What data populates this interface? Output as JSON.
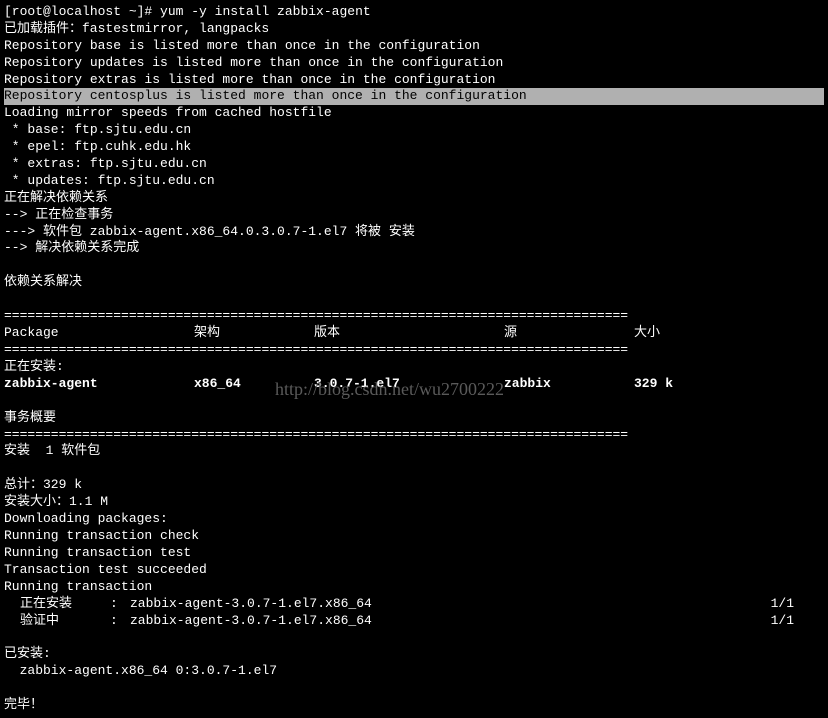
{
  "prompt": "[root@localhost ~]# ",
  "command": "yum -y install zabbix-agent",
  "plugins_line": "已加载插件：fastestmirror, langpacks",
  "repo_warn_base": "Repository base is listed more than once in the configuration",
  "repo_warn_updates": "Repository updates is listed more than once in the configuration",
  "repo_warn_extras": "Repository extras is listed more than once in the configuration",
  "repo_warn_centosplus": "Repository centosplus is listed more than once in the configuration",
  "loading_mirror": "Loading mirror speeds from cached hostfile",
  "mirror_base": " * base: ftp.sjtu.edu.cn",
  "mirror_epel": " * epel: ftp.cuhk.edu.hk",
  "mirror_extras": " * extras: ftp.sjtu.edu.cn",
  "mirror_updates": " * updates: ftp.sjtu.edu.cn",
  "dep_resolve": "正在解决依赖关系",
  "dep_check": "--> 正在检查事务",
  "dep_pkg": "---> 软件包 zabbix-agent.x86_64.0.3.0.7-1.el7 将被 安装",
  "dep_done": "--> 解决依赖关系完成",
  "dep_resolved_hdr": "依赖关系解决",
  "rule_eq": "================================================================================",
  "hdr_package": " Package",
  "hdr_arch": "架构",
  "hdr_version": "版本",
  "hdr_repo": "源",
  "hdr_size": "大小",
  "installing_hdr": "正在安装:",
  "pkg_name": " zabbix-agent",
  "pkg_arch": "x86_64",
  "pkg_ver": "3.0.7-1.el7",
  "pkg_repo": "zabbix",
  "pkg_size": "329 k",
  "trans_summary": "事务概要",
  "install_count": "安装  1 软件包",
  "total": "总计：329 k",
  "install_size": "安装大小：1.1 M",
  "downloading": "Downloading packages:",
  "run_check": "Running transaction check",
  "run_test": "Running transaction test",
  "test_ok": "Transaction test succeeded",
  "running": "Running transaction",
  "action_install": "正在安装",
  "action_verify": "验证中",
  "colon": ":",
  "trans_pkg_full": "zabbix-agent-3.0.7-1.el7.x86_64",
  "count_1_1": "1/1",
  "installed_hdr": "已安装:",
  "installed_pkg": "  zabbix-agent.x86_64 0:3.0.7-1.el7",
  "complete": "完毕！",
  "watermark": "http://blog.csdn.net/wu2700222"
}
